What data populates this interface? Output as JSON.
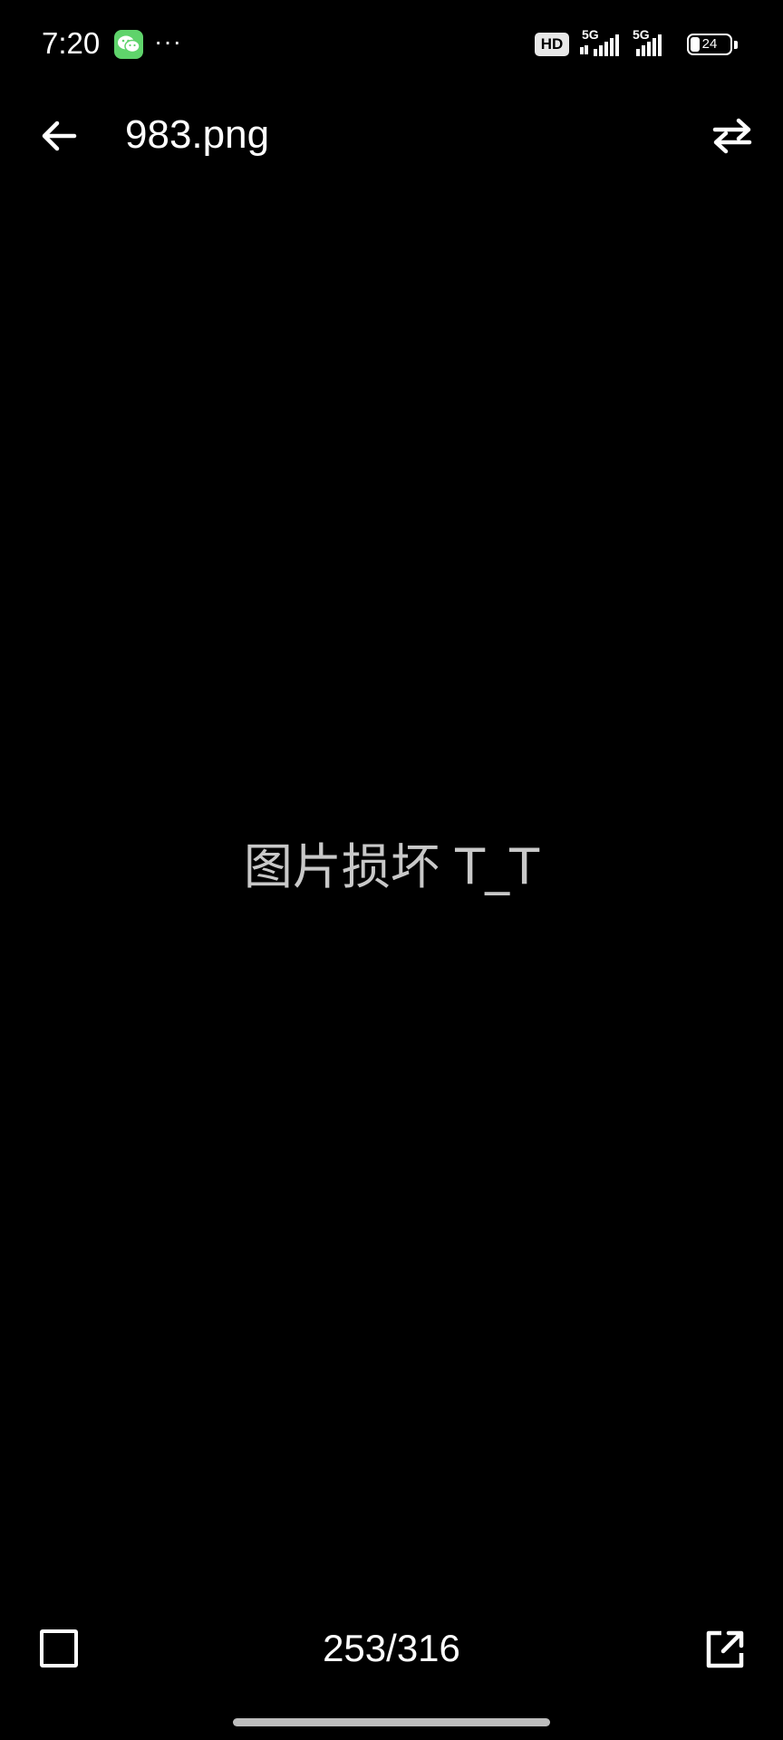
{
  "status_bar": {
    "time": "7:20",
    "dots": "···",
    "hd_label": "HD",
    "signal1_label": "5G",
    "signal2_label": "5G",
    "battery_level": "24",
    "icons": [
      "wechat-icon",
      "hd-voice-icon",
      "signal-5g-icon",
      "signal-5g-icon",
      "battery-icon"
    ]
  },
  "app_bar": {
    "title": "983.png",
    "back_icon": "arrow-left-icon",
    "swap_icon": "swap-arrows-icon"
  },
  "content": {
    "error_message": "图片损坏 T_T"
  },
  "bottom_bar": {
    "page_counter": "253/316",
    "checkbox_icon": "checkbox-icon",
    "open_icon": "open-external-icon"
  },
  "colors": {
    "background": "#000000",
    "text": "#ffffff",
    "muted_text": "#c8c8c8",
    "wechat_green": "#5fd36b"
  }
}
